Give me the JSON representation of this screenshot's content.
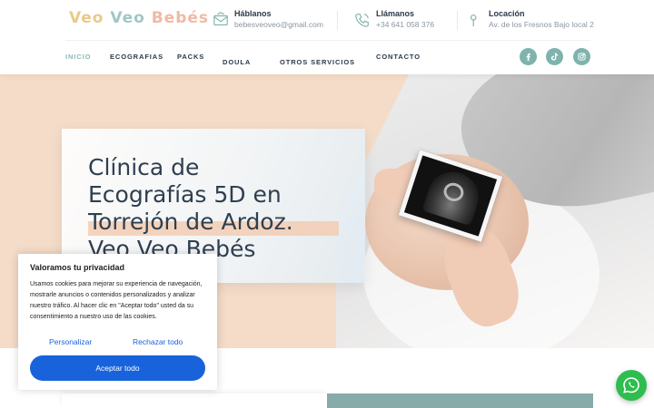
{
  "brand": {
    "logo_words": [
      "Veo",
      "Veo",
      "Bebés"
    ]
  },
  "header": {
    "contacts": [
      {
        "icon": "mail-icon",
        "title": "Háblanos",
        "detail": "bebesveoveo@gmail.com"
      },
      {
        "icon": "phone-icon",
        "title": "Llámanos",
        "detail": "+34 641 058 376"
      },
      {
        "icon": "location-pin-icon",
        "title": "Locación",
        "detail": "Av. de los Fresnos Bajo local 2"
      }
    ]
  },
  "nav": {
    "items": [
      {
        "label": "INICIO",
        "active": true
      },
      {
        "label": "ECOGRAFIAS"
      },
      {
        "label": "PACKS"
      },
      {
        "label": "DOULA",
        "dropdown": true
      },
      {
        "label": "OTROS SERVICIOS",
        "dropdown": true
      },
      {
        "label": "CONTACTO"
      }
    ],
    "social": [
      "facebook-icon",
      "tiktok-icon",
      "instagram-icon"
    ]
  },
  "hero": {
    "title_lines": [
      "Clínica de",
      "Ecografías 5D en",
      "Torrejón de Ardoz.",
      "Veo Veo Bebés"
    ]
  },
  "cookie": {
    "title": "Valoramos tu privacidad",
    "text": "Usamos cookies para mejorar su experiencia de navegación, mostrarle anuncios o contenidos personalizados y analizar nuestro tráfico. Al hacer clic en \"Aceptar todo\" usted da su consentimiento a nuestro uso de las cookies.",
    "customize_label": "Personalizar",
    "reject_label": "Rechazar todo",
    "accept_label": "Aceptar todo"
  },
  "colors": {
    "accent": "#86b9b4",
    "social_bg": "#7fb3ad",
    "hero_peach": "#f4dcc8",
    "cookie_primary": "#1863dc",
    "whatsapp": "#2ebd4e"
  },
  "floating": {
    "icon": "whatsapp-icon"
  }
}
